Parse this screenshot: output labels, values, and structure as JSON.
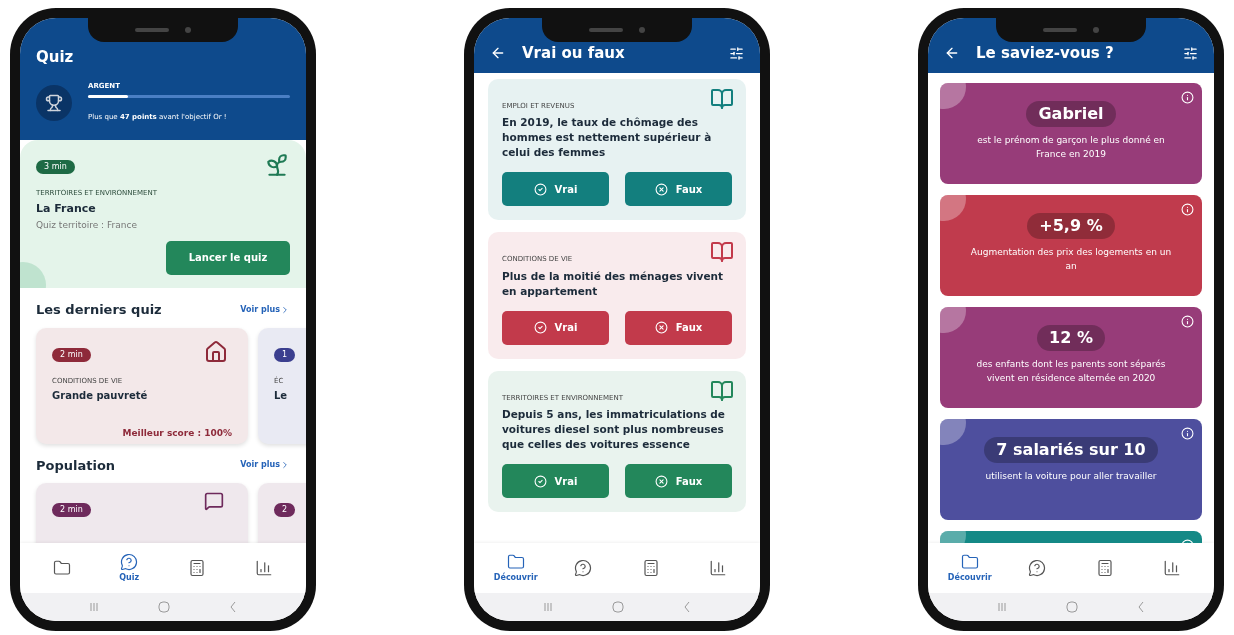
{
  "phones": [
    {
      "kind": "quiz",
      "header": {
        "title": "Quiz"
      },
      "progress": {
        "rank": "ARGENT",
        "level": 0.2,
        "message": "Plus que **47 points** avant l'objectif Or !"
      },
      "featured": {
        "duration": "3 min",
        "category": "TERRITOIRES ET ENVIRONNEMENT",
        "title": "La France",
        "subtitle": "Quiz territoire : France",
        "button": "Lancer le quiz"
      },
      "sections": [
        {
          "title": "Les derniers quiz",
          "link": "Voir plus",
          "cards": [
            {
              "duration": "2 min",
              "category": "CONDITIONS DE VIE",
              "title": "Grande pauvreté",
              "score": "Meilleur score : 100%",
              "color": "#8e2a3a"
            },
            {
              "duration": "1",
              "category": "ÉC",
              "title": "Le",
              "color": "#3b3f8f"
            }
          ]
        },
        {
          "title": "Population",
          "link": "Voir plus",
          "cards": [
            {
              "duration": "2 min",
              "color": "#6e2a5c"
            },
            {
              "duration": "2",
              "color": "#6e2a5c"
            }
          ]
        }
      ],
      "nav": [
        {
          "selected": false
        },
        {
          "label": "Quiz",
          "selected": true
        },
        {
          "selected": false
        },
        {
          "selected": false
        }
      ]
    },
    {
      "kind": "true_false",
      "header": {
        "title": "Vrai ou faux"
      },
      "questions": [
        {
          "category": "EMPLOI ET REVENUS",
          "question": "En 2019, le taux de chômage des hommes est nettement supérieur à celui des femmes",
          "color": "#137f7e",
          "answers": [
            "Vrai",
            "Faux"
          ]
        },
        {
          "category": "CONDITIONS DE VIE",
          "question": "Plus de la moitié des ménages vivent en appartement",
          "color": "#c23a4b",
          "answers": [
            "Vrai",
            "Faux"
          ]
        },
        {
          "category": "TERRITOIRES ET ENVIRONNEMENT",
          "question": "Depuis 5 ans, les immatriculations de voitures diesel sont plus nombreuses que celles des voitures essence",
          "color": "#23875b",
          "answers": [
            "Vrai",
            "Faux"
          ]
        }
      ],
      "nav": [
        {
          "label": "Découvrir",
          "selected": true
        },
        {
          "selected": false
        },
        {
          "selected": false
        },
        {
          "selected": false
        }
      ]
    },
    {
      "kind": "facts",
      "header": {
        "title": "Le saviez-vous ?"
      },
      "facts": [
        {
          "highlight": "Gabriel",
          "text": "est le prénom de garçon le plus donné en France en 2019",
          "color": "#973c79"
        },
        {
          "highlight": "+5,9 %",
          "text": "Augmentation des prix des logements en un an",
          "color": "#c03b4d"
        },
        {
          "highlight": "12 %",
          "text": "des enfants dont les parents sont séparés vivent en résidence alternée en 2020",
          "color": "#973c79"
        },
        {
          "highlight": "7 salariés sur 10",
          "text": "utilisent la voiture pour aller travailler",
          "color": "#4e4f9e"
        },
        {
          "color": "#148986"
        }
      ],
      "nav": [
        {
          "label": "Découvrir",
          "selected": true
        },
        {
          "selected": false
        },
        {
          "selected": false
        },
        {
          "selected": false
        }
      ]
    }
  ]
}
